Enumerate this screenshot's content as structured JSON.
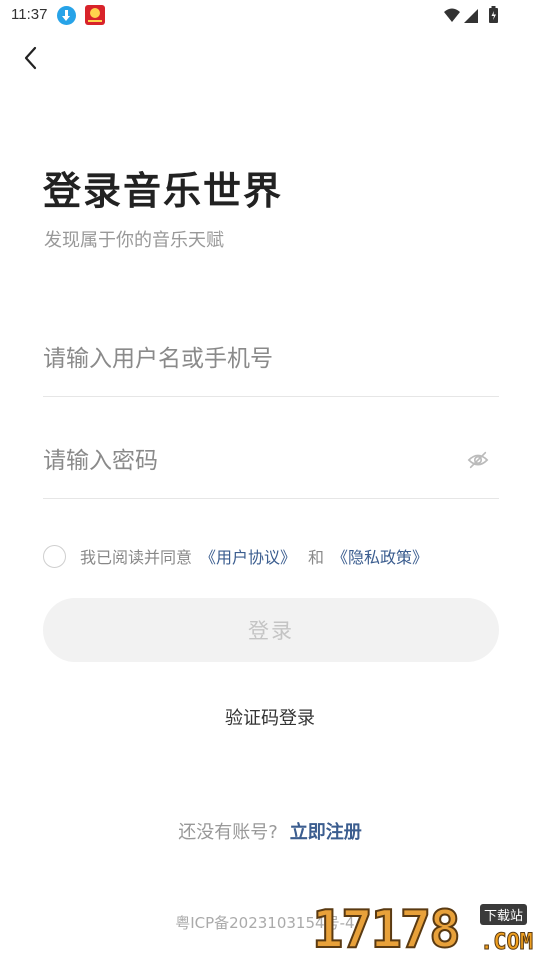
{
  "status_bar": {
    "time": "11:37",
    "icons": [
      "download-notification-icon",
      "app-notification-icon",
      "wifi-icon",
      "signal-icon",
      "battery-icon"
    ]
  },
  "header": {
    "back_icon": "chevron-left-icon"
  },
  "main": {
    "title": "登录音乐世界",
    "subtitle": "发现属于你的音乐天赋",
    "username": {
      "value": "",
      "placeholder": "请输入用户名或手机号"
    },
    "password": {
      "value": "",
      "placeholder": "请输入密码",
      "toggle_icon": "eye-off-icon"
    },
    "agreement": {
      "prefix": "我已阅读并同意",
      "user_agreement": "《用户协议》",
      "and": "和",
      "privacy_policy": "《隐私政策》",
      "checked": false
    },
    "login_button": "登录",
    "code_login": "验证码登录"
  },
  "footer": {
    "no_account": "还没有账号?",
    "register": "立即注册",
    "icp": "粤ICP备2023103154号-4A"
  },
  "watermark": {
    "number": "17178",
    "tag": "下载站",
    "domain": ".COM"
  },
  "colors": {
    "accent": "#3b5d8f",
    "button_bg": "#f2f2f2",
    "button_text": "#c4c4c4"
  }
}
